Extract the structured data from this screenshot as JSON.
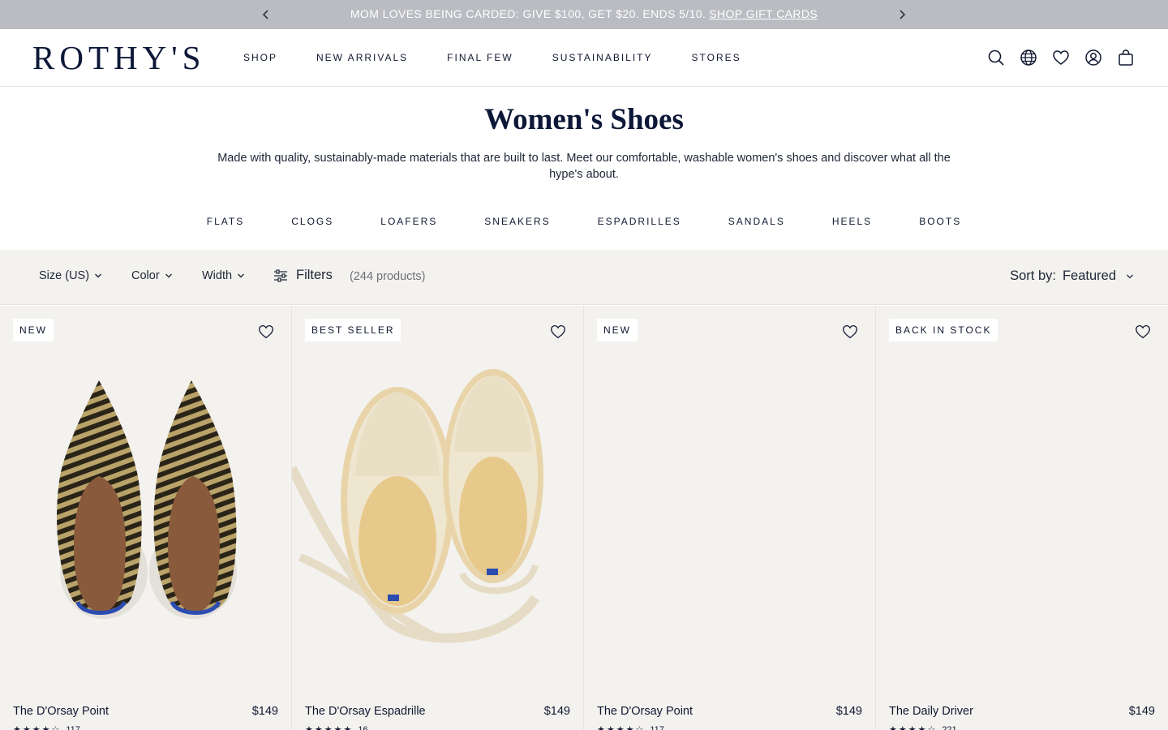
{
  "promo": {
    "text": "MOM LOVES BEING CARDED: GIVE $100, GET $20. ENDS 5/10.",
    "link": "SHOP GIFT CARDS"
  },
  "header": {
    "logo": "ROTHY'S",
    "nav": [
      "SHOP",
      "NEW ARRIVALS",
      "FINAL FEW",
      "SUSTAINABILITY",
      "STORES"
    ],
    "icons": [
      "search-icon",
      "globe-icon",
      "heart-icon",
      "account-icon",
      "bag-icon"
    ]
  },
  "page": {
    "title": "Women's Shoes",
    "description": "Made with quality, sustainably-made materials that are built to last. Meet our comfortable, washable women's shoes and discover what all the hype's about.",
    "categories": [
      "FLATS",
      "CLOGS",
      "LOAFERS",
      "SNEAKERS",
      "ESPADRILLES",
      "SANDALS",
      "HEELS",
      "BOOTS"
    ]
  },
  "filters": {
    "size": "Size (US)",
    "color": "Color",
    "width": "Width",
    "filters": "Filters",
    "count": "(244 products)",
    "sort_label": "Sort by:",
    "sort_value": "Featured"
  },
  "products": [
    {
      "badge": "NEW",
      "name": "The D'Orsay Point",
      "price": "$149",
      "rating": 4.5,
      "reviews": "117",
      "image": "pointed-flat-woven-stripe"
    },
    {
      "badge": "BEST SELLER",
      "name": "The D'Orsay Espadrille",
      "price": "$149",
      "rating": 5,
      "reviews": "16",
      "image": "espadrille-cream-ties"
    },
    {
      "badge": "NEW",
      "name": "The D'Orsay Point",
      "price": "$149",
      "rating": 4.5,
      "reviews": "117",
      "image": "blank"
    },
    {
      "badge": "BACK IN STOCK",
      "name": "The Daily Driver",
      "price": "$149",
      "rating": 4.5,
      "reviews": "221",
      "image": "blank"
    }
  ],
  "colors": {
    "navy": "#0d1838",
    "promo_bg": "#babcc2",
    "card_bg": "#f3f2ef"
  }
}
